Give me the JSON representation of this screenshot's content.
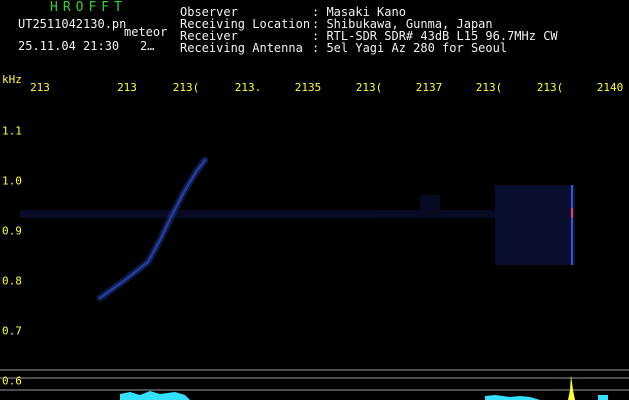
{
  "header": {
    "program_title": "HROFFT",
    "filename": "UT2511042130.pn",
    "filename_suffix": "meteor",
    "datetime": "25.11.04 21:30",
    "datetime_extra": "2…",
    "fields": [
      {
        "label": "Observer",
        "value": ": Masaki Kano"
      },
      {
        "label": "Receiving Location",
        "value": ": Shibukawa, Gunma, Japan"
      },
      {
        "label": "Receiver",
        "value": ": RTL-SDR SDR# 43dB L15 96.7MHz CW"
      },
      {
        "label": "Receiving Antenna",
        "value": ": 5el Yagi Az 280 for Seoul"
      }
    ]
  },
  "axes": {
    "y_unit": "kHz",
    "x_ticks": [
      "213",
      "213",
      "213(",
      "213.",
      "2135",
      "213(",
      "2137",
      "213(",
      "213(",
      "2140"
    ],
    "y_ticks": [
      "1.1",
      "1.0",
      "0.9",
      "0.8",
      "0.7",
      "0.6"
    ]
  },
  "colors": {
    "background": "#000000",
    "axis_text": "#ffff33",
    "title_green": "#2fd12f",
    "trace_blue": "#2a5cff",
    "noise_blue": "#1b2a6a",
    "signal_cyan": "#33e0ff",
    "baseline_gray": "#9a9a9a"
  }
}
